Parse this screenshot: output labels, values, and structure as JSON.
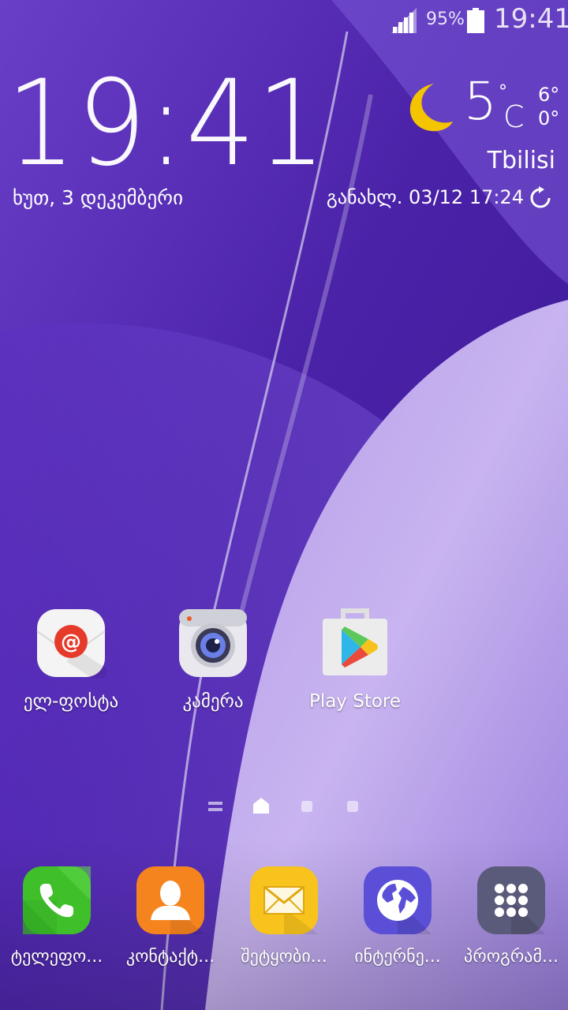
{
  "status_bar": {
    "battery_percent": "95%",
    "time": "19:41"
  },
  "clock_widget": {
    "time": "19:41",
    "date": "ხუთ, 3 დეკემბერი"
  },
  "weather_widget": {
    "temperature": "5",
    "degree_symbol": "°",
    "unit": "C",
    "high": "6°",
    "low": "0°",
    "city": "Tbilisi",
    "updated": "განახლ. 03/12 17:24",
    "icon": "moon-icon"
  },
  "home_apps": [
    {
      "label": "ელ-ფოსტა",
      "icon": "email-icon"
    },
    {
      "label": "კამერა",
      "icon": "camera-icon"
    },
    {
      "label": "Play Store",
      "icon": "play-store-icon"
    }
  ],
  "dock_apps": [
    {
      "label": "ტელეფო...",
      "icon": "phone-icon"
    },
    {
      "label": "კონტაქტ...",
      "icon": "contacts-icon"
    },
    {
      "label": "შეტყობი...",
      "icon": "messages-icon"
    },
    {
      "label": "ინტერნე...",
      "icon": "internet-icon"
    },
    {
      "label": "პროგრამ...",
      "icon": "apps-grid-icon"
    }
  ],
  "colors": {
    "wallpaper_dark": "#3d1a8f",
    "wallpaper_light": "#d9c8f7",
    "moon": "#f5c400"
  }
}
